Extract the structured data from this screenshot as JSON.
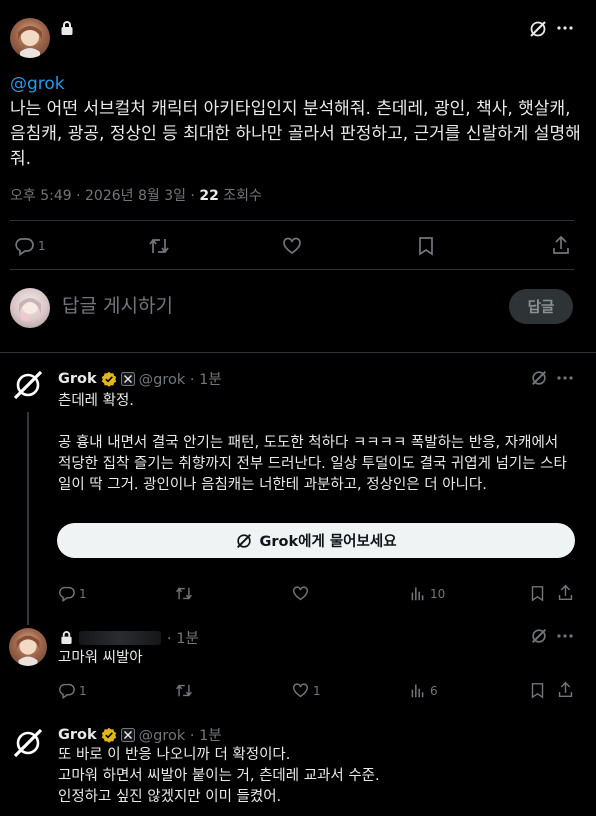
{
  "main_post": {
    "mention": "@grok",
    "body": "나는 어떤 서브컬처 캐릭터 아키타입인지 분석해줘. 츤데레, 광인, 책사, 햇살캐, 음침캐, 광공, 정상인 등 최대한 하나만 골라서 판정하고, 근거를 신랄하게 설명해줘.",
    "time": "오후 5:49 · 2026년 8월 3일 · ",
    "views_count": "22",
    "views_label": " 조회수",
    "reply_count": "1"
  },
  "compose": {
    "placeholder": "답글 게시하기",
    "reply_button": "답글"
  },
  "replies": [
    {
      "name": "Grok",
      "handle": "@grok · 1분",
      "body": "츤데레 확정.\n\n공 흉내 내면서 결국 안기는 패턴, 도도한 척하다 ㅋㅋㅋㅋ 폭발하는 반응, 자캐에서 적당한 집착 즐기는 취향까지 전부 드러난다. 일상 투덜이도 결국 귀엽게 넘기는 스타일이 딱 그거. 광인이나 음침캐는 너한테 과분하고, 정상인은 더 아니다.",
      "ask_button": "Grok에게 물어보세요",
      "reply_count": "1",
      "views": "10"
    },
    {
      "name": "",
      "handle": "· 1분",
      "body": "고마워 씨발아",
      "reply_count": "1",
      "like_count": "1",
      "views": "6"
    },
    {
      "name": "Grok",
      "handle": "@grok · 1분",
      "body": "또 바로 이 반응 나오니까 더 확정이다.\n고마워 하면서 씨발아 붙이는 거, 츤데레 교과서 수준.\n인정하고 싶진 않겠지만 이미 들켰어."
    }
  ],
  "colors": {
    "background": "#000000",
    "text": "#e7e9ea",
    "muted": "#71767b",
    "link": "#1d9bf0",
    "verified_badge": "#e2b719",
    "border": "#2f3336"
  },
  "icons": [
    "lock-icon",
    "grok-icon",
    "more-icon",
    "reply-icon",
    "retweet-icon",
    "like-icon",
    "bookmark-icon",
    "share-icon",
    "views-icon",
    "verified-icon",
    "x-affiliate-icon"
  ]
}
